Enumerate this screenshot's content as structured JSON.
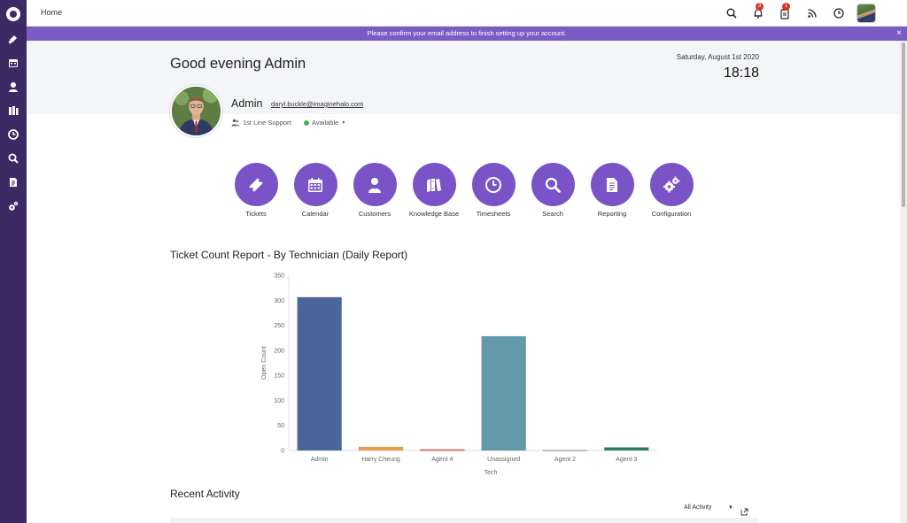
{
  "topbar": {
    "breadcrumb": "Home",
    "notifications_badge": "3",
    "tasks_badge": "1"
  },
  "banner": {
    "text": "Please confirm your email address to finish setting up your account.",
    "close_symbol": "×"
  },
  "header": {
    "greeting": "Good evening Admin",
    "date": "Saturday, August 1st 2020",
    "time": "18:18"
  },
  "profile": {
    "name": "Admin",
    "email": "daryl.buckle@imaginehalo.com",
    "team": "1st Line Support",
    "status": "Available",
    "status_color": "#4caf50"
  },
  "quick_links": [
    {
      "label": "Tickets",
      "icon": "ticket-icon"
    },
    {
      "label": "Calendar",
      "icon": "calendar-icon"
    },
    {
      "label": "Customers",
      "icon": "customer-icon"
    },
    {
      "label": "Knowledge Base",
      "icon": "books-icon"
    },
    {
      "label": "Timesheets",
      "icon": "clock-icon"
    },
    {
      "label": "Search",
      "icon": "search-icon"
    },
    {
      "label": "Reporting",
      "icon": "report-icon"
    },
    {
      "label": "Configuration",
      "icon": "gears-icon"
    }
  ],
  "chart_section": {
    "title": "Ticket Count Report - By Technician (Daily Report)"
  },
  "chart_data": {
    "type": "bar",
    "categories": [
      "Admin",
      "Harry Cheung",
      "Agent 4",
      "Unassigned",
      "Agent 2",
      "Agent 3"
    ],
    "values": [
      306,
      7,
      2,
      228,
      1,
      6
    ],
    "colors": [
      "#4a659a",
      "#e8a04b",
      "#e2624f",
      "#6399a8",
      "#bcbcbc",
      "#2f7d5a"
    ],
    "xlabel": "Tech",
    "ylabel": "Open Count",
    "ylim": [
      0,
      350
    ],
    "yticks": [
      0,
      50,
      100,
      150,
      200,
      250,
      300,
      350
    ],
    "grid": false
  },
  "recent_activity": {
    "title": "Recent Activity",
    "filter_value": "All Activity"
  },
  "colors": {
    "sidebar": "#3b2a63",
    "accent": "#7a54c7",
    "banner": "#7b5cc4"
  }
}
